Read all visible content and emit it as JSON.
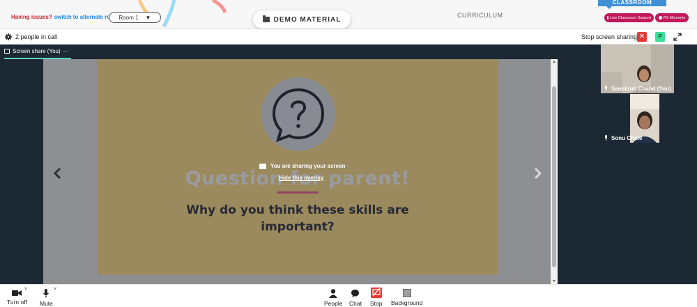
{
  "topbar": {
    "issues_label": "Having issues?",
    "switch_label": "switch to alternate room",
    "room_label": "Room 1",
    "demo_label": "DEMO MATERIAL",
    "curriculum_label": "CURRICULUM",
    "classroom_tab_label": "CLASSROOM",
    "support_label": "Live Classroom Support",
    "moments_label": "PS Moments"
  },
  "callbar": {
    "people_count": "2 people in call",
    "stop_sharing_label": "Stop screen sharing",
    "avatar_letter": "P"
  },
  "stage": {
    "tab_label": "Screen share (You)",
    "tab_menu": "⋯",
    "sharing_message": "You are sharing your screen",
    "hide_overlay_label": "Hide this overlay",
    "slide_title": "Question for parent!",
    "slide_question": "Why do you think these skills are important?"
  },
  "participants": [
    {
      "name": "Sanskruti Chand (You)"
    },
    {
      "name": "Sonu Chate"
    }
  ],
  "controls": {
    "camera_label": "Turn off",
    "mute_label": "Mute",
    "people_label": "People",
    "chat_label": "Chat",
    "stop_label": "Stop",
    "background_label": "Background"
  },
  "colors": {
    "accent_red": "#e53935",
    "pill_magenta": "#c2185b",
    "stage_bg": "#1c2833",
    "slide_yellow": "#ffe08a",
    "share_teal": "#5fd4c3",
    "avatar_green": "#3ddc97"
  }
}
